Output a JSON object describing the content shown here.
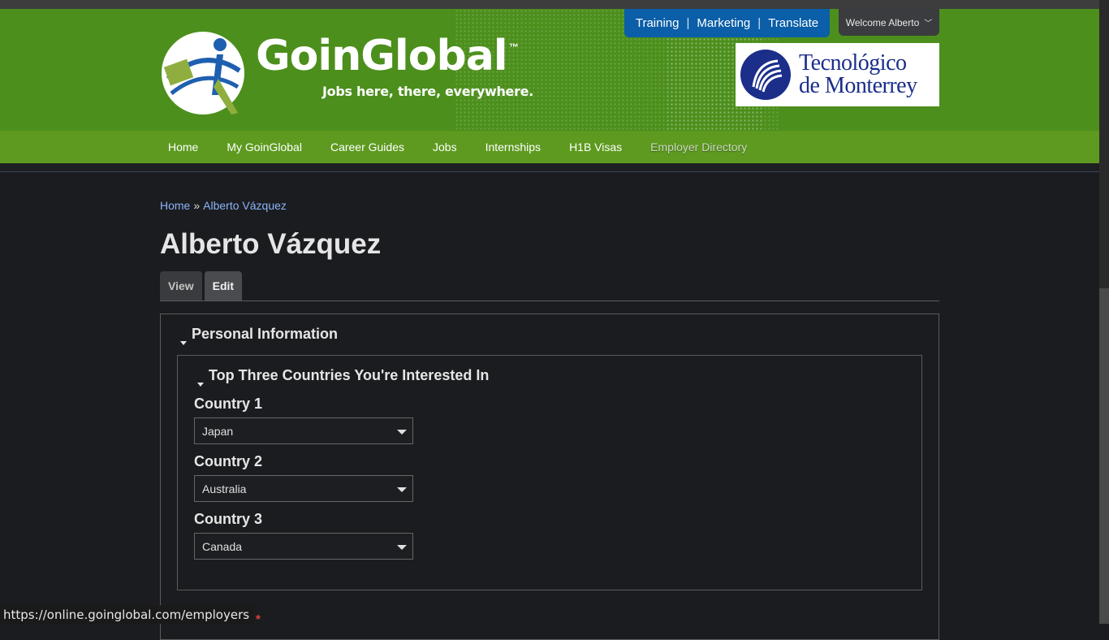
{
  "header": {
    "brand": "GoinGlobal",
    "trademark": "™",
    "tagline": "Jobs here, there, everywhere.",
    "util_links": [
      "Training",
      "Marketing",
      "Translate"
    ],
    "util_separator": "|",
    "welcome": "Welcome Alberto",
    "partner_logo_line1": "Tecnológico",
    "partner_logo_line2": "de Monterrey"
  },
  "nav": {
    "items": [
      "Home",
      "My GoinGlobal",
      "Career Guides",
      "Jobs",
      "Internships",
      "H1B Visas",
      "Employer Directory"
    ]
  },
  "breadcrumb": {
    "home": "Home",
    "separator": "»",
    "current": "Alberto Vázquez"
  },
  "page": {
    "title": "Alberto Vázquez",
    "tabs": [
      "View",
      "Edit"
    ],
    "active_tab": "Edit"
  },
  "form": {
    "personal_info_legend": "Personal Information",
    "countries_legend": "Top Three Countries You're Interested In",
    "country1_label": "Country 1",
    "country1_value": "Japan",
    "country2_label": "Country 2",
    "country2_value": "Australia",
    "country3_label": "Country 3",
    "country3_value": "Canada",
    "required_marker": "*"
  },
  "status_bar": {
    "url": "https://online.goinglobal.com/employers"
  },
  "colors": {
    "header_green": "#4c8f1c",
    "nav_green": "#5d9a1f",
    "util_blue": "#0b5ea8",
    "page_bg": "#1b1c1f",
    "link": "#8ab4f8"
  }
}
